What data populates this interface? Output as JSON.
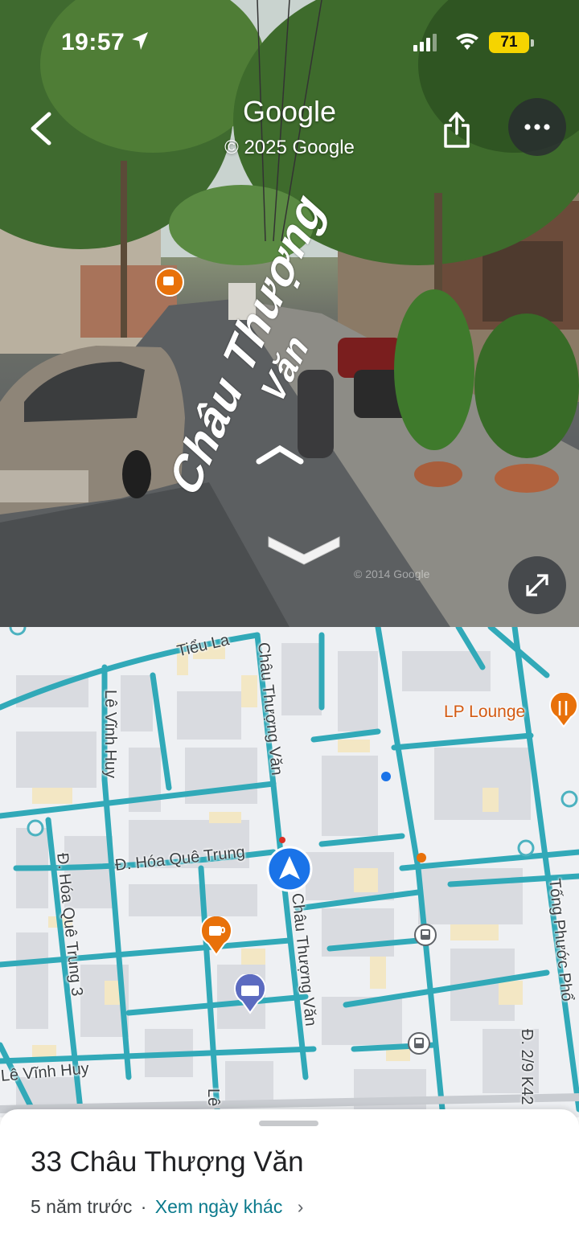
{
  "status_bar": {
    "time": "19:57",
    "battery": "71"
  },
  "street_view": {
    "title": "Google",
    "copyright": "© 2025 Google",
    "watermark": "© 2014 Google",
    "road_label_main": "Châu Thượng",
    "road_label_sub": "Văn"
  },
  "map": {
    "streets": [
      "Tiểu La",
      "Lê Vĩnh Huy",
      "Châu Thượng Văn",
      "Đ. Hóa Quê Trung",
      "Châu Thượng Văn",
      "Đ. Hóa Quê Trung 3",
      "Lê Vĩnh Huy",
      "Tống Phước Phổ",
      "Lê",
      "Đ. 2/9 K42"
    ],
    "poi_label": "LP Lounge"
  },
  "place": {
    "title": "33 Châu Thượng Văn",
    "age": "5 năm trước",
    "separator": "·",
    "other_dates": "Xem ngày khác",
    "chevron": "›"
  },
  "colors": {
    "road": "#31a9b8",
    "accent_link": "#0b7a8c",
    "poi": "#e8710a",
    "location": "#1a73e8"
  }
}
